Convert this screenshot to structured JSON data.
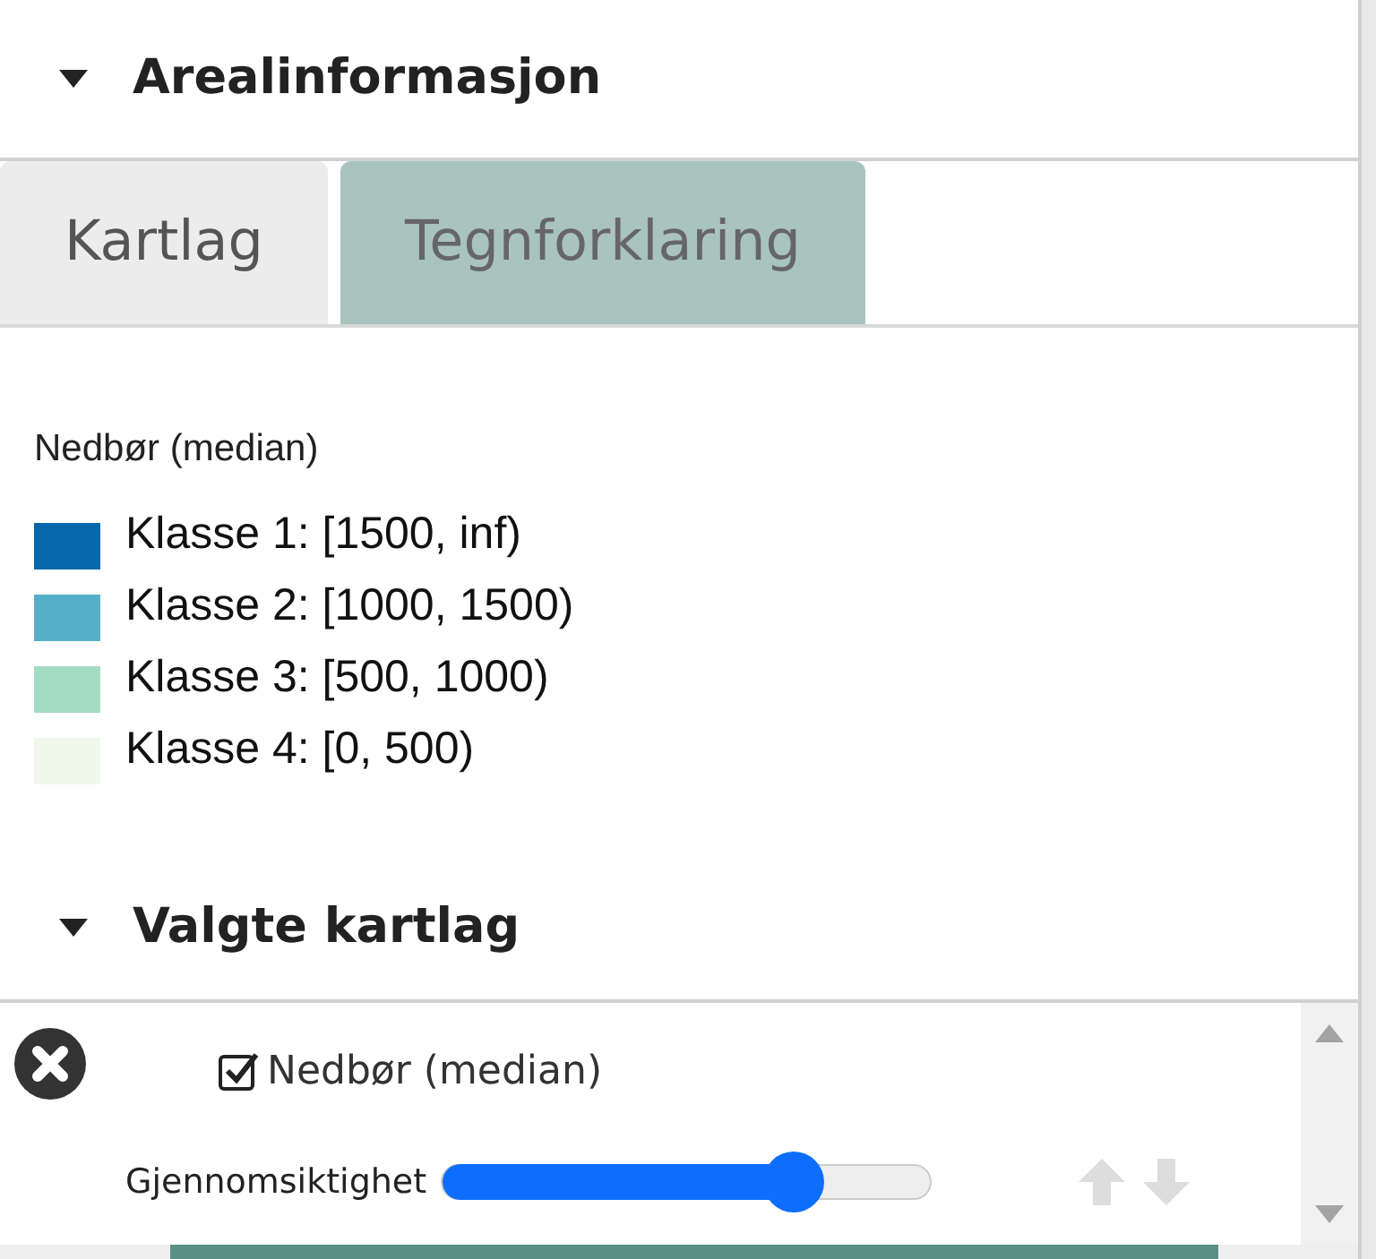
{
  "section": {
    "title": "Arealinformasjon",
    "expanded": true
  },
  "tabs": [
    {
      "label": "Kartlag",
      "selected": false
    },
    {
      "label": "Tegnforklaring",
      "selected": true
    }
  ],
  "legend": {
    "title": "Nedbør (median)",
    "classes": [
      {
        "label": "Klasse 1: [1500, inf)",
        "color": "#0767ad"
      },
      {
        "label": "Klasse 2: [1000, 1500)",
        "color": "#56afc8"
      },
      {
        "label": "Klasse 3: [500, 1000)",
        "color": "#a3dcc2"
      },
      {
        "label": "Klasse 4: [0, 500)",
        "color": "#eff8ea"
      }
    ]
  },
  "selected_layers": {
    "title": "Valgte kartlag",
    "expanded": true,
    "layers": [
      {
        "name": "Nedbør (median)",
        "checked": true,
        "opacity_label": "Gjennomsiktighet",
        "level": 0.72
      }
    ]
  }
}
